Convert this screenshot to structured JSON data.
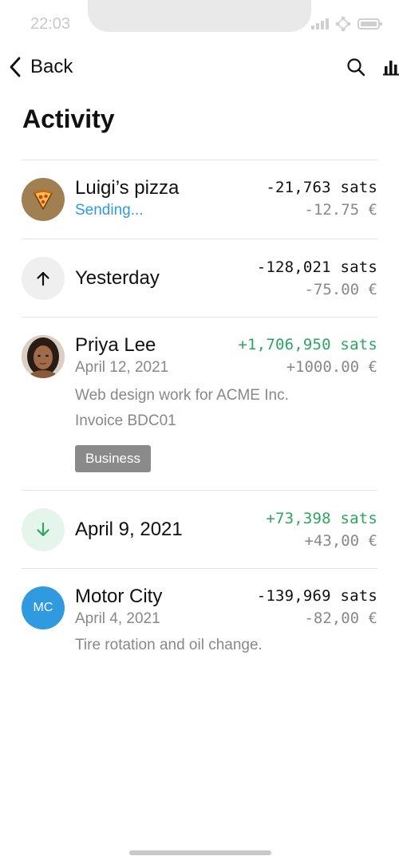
{
  "status": {
    "time": "22:03"
  },
  "nav": {
    "back_label": "Back",
    "icons": [
      "search-icon",
      "bar-chart-icon"
    ]
  },
  "page": {
    "title": "Activity"
  },
  "activity": [
    {
      "name": "Luigi’s pizza",
      "subtitle": "Sending...",
      "sats": "-21,763 sats",
      "fiat": "-12.75 €",
      "avatar": "pizza-icon"
    },
    {
      "name": "Yesterday",
      "sats": "-128,021 sats",
      "fiat": "-75.00 €",
      "avatar": "arrow-up-icon"
    },
    {
      "name": "Priya Lee",
      "subtitle": "April 12, 2021",
      "sats": "+1,706,950 sats",
      "fiat": "+1000.00 €",
      "memo_line1": "Web design work for ACME Inc.",
      "memo_line2": "Invoice BDC01",
      "tag": "Business",
      "avatar": "photo"
    },
    {
      "name": "April 9, 2021",
      "sats": "+73,398 sats",
      "fiat": "+43,00 €",
      "avatar": "arrow-down-icon"
    },
    {
      "name": "Motor City",
      "subtitle": "April 4, 2021",
      "sats": "-139,969 sats",
      "fiat": "-82,00 €",
      "memo": "Tire rotation and oil change.",
      "avatar_initials": "MC"
    }
  ],
  "colors": {
    "accent_blue": "#2f9adf",
    "positive_green": "#2ea55f",
    "muted": "#888888",
    "avatar_blue": "#2f9adf",
    "pizza_bg": "#a08050"
  }
}
